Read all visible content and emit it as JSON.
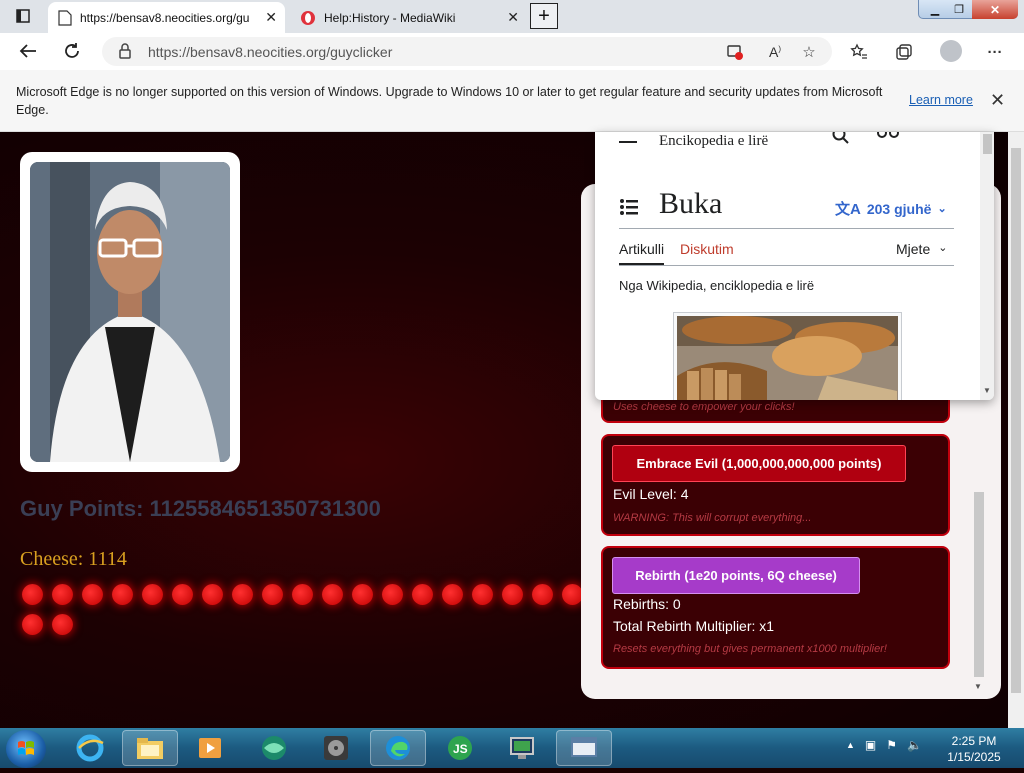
{
  "browser": {
    "tabs": [
      {
        "title": "https://bensav8.neocities.org/gu",
        "active": true
      },
      {
        "title": "Help:History - MediaWiki",
        "active": false
      }
    ],
    "new_tab": "+",
    "close_glyph": "✕",
    "url": "https://bensav8.neocities.org/guyclicker",
    "more_glyph": "···"
  },
  "infobar": {
    "message": "Microsoft Edge is no longer supported on this version of Windows. Upgrade to Windows 10 or later to get regular feature and security updates from Microsoft Edge.",
    "learn_more": "Learn more"
  },
  "game": {
    "guy_points": "Guy Points: 1125584651350731300",
    "cheese": "Cheese: 1114",
    "dot_count": 21,
    "cheese_upgrade_note": "Uses cheese to empower your clicks!",
    "evil_button": "Embrace Evil (1,000,000,000,000 points)",
    "evil_level": "Evil Level: 4",
    "evil_warning": "WARNING: This will corrupt everything...",
    "rebirth_button": "Rebirth (1e20 points, 6Q cheese)",
    "rebirths": "Rebirths: 0",
    "rebirth_multiplier": "Total Rebirth Multiplier: x1",
    "rebirth_note": "Resets everything but gives permanent x1000 multiplier!"
  },
  "wiki": {
    "tagline": "Encikopedia e lirë",
    "title": "Buka",
    "languages": "203 gjuhë",
    "tab_article": "Artikulli",
    "tab_discussion": "Diskutim",
    "tools": "Mjete",
    "from": "Nga Wikipedia, enciklopedia e lirë"
  },
  "taskbar": {
    "time": "2:25 PM",
    "date": "1/15/2025"
  },
  "colors": {
    "evil_red": "#b00010",
    "rebirth_purple": "#a63bc9",
    "cheese_gold": "#d9a020",
    "wiki_link": "#36c"
  }
}
